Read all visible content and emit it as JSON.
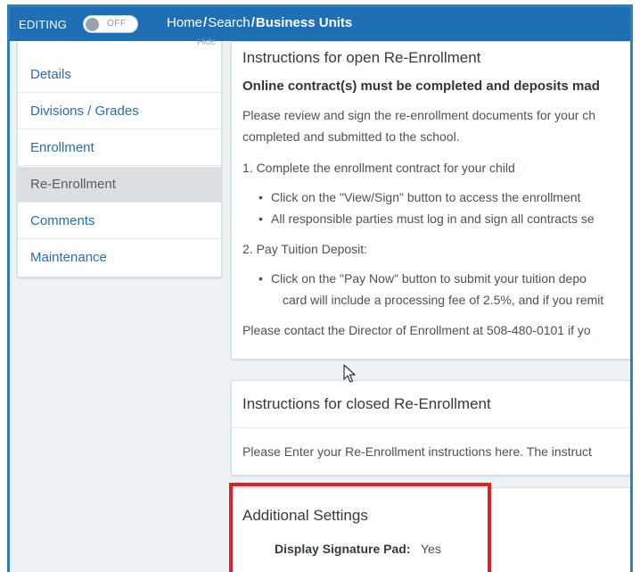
{
  "topbar": {
    "editing_label": "EDITING",
    "toggle_state": "OFF",
    "breadcrumb": {
      "home": "Home",
      "separator": "/",
      "search": "Search",
      "current": "Business Units"
    }
  },
  "sidebar": {
    "hide_label": "Hide",
    "items": [
      {
        "label": "Details",
        "active": false
      },
      {
        "label": "Divisions / Grades",
        "active": false
      },
      {
        "label": "Enrollment",
        "active": false
      },
      {
        "label": "Re-Enrollment",
        "active": true
      },
      {
        "label": "Comments",
        "active": false
      },
      {
        "label": "Maintenance",
        "active": false
      }
    ]
  },
  "open_panel": {
    "title": "Instructions for open Re-Enrollment",
    "bold_line": "Online contract(s) must be completed and deposits mad",
    "intro_line1": "Please review and sign the re-enrollment documents for your ch",
    "intro_line2": "completed and submitted to the school.",
    "step1": "1. Complete the enrollment contract for your child",
    "step1_bullet1": "Click on the \"View/Sign\" button to access the enrollment",
    "step1_bullet2": "All responsible parties must log in and sign all contracts se",
    "step2": "2. Pay Tuition Deposit:",
    "step2_bullet1": "Click on the \"Pay Now\" button to submit your tuition depo",
    "step2_bullet1_cont": "card will include a processing fee of 2.5%, and if you remit",
    "contact_line": "Please contact the Director of Enrollment at 508-480-0101 if yo"
  },
  "closed_panel": {
    "title": "Instructions for closed Re-Enrollment",
    "text": "Please Enter your Re-Enrollment instructions here. The instruct"
  },
  "settings_panel": {
    "title": "Additional Settings",
    "signature_label": "Display Signature Pad:",
    "signature_value": "Yes"
  },
  "colors": {
    "topbar": "#1f6fb5",
    "link": "#2a6db0",
    "highlight": "#e21f26",
    "frame_border": "#2f7fc1"
  },
  "icons": {
    "cursor": "mouse-pointer-icon"
  }
}
